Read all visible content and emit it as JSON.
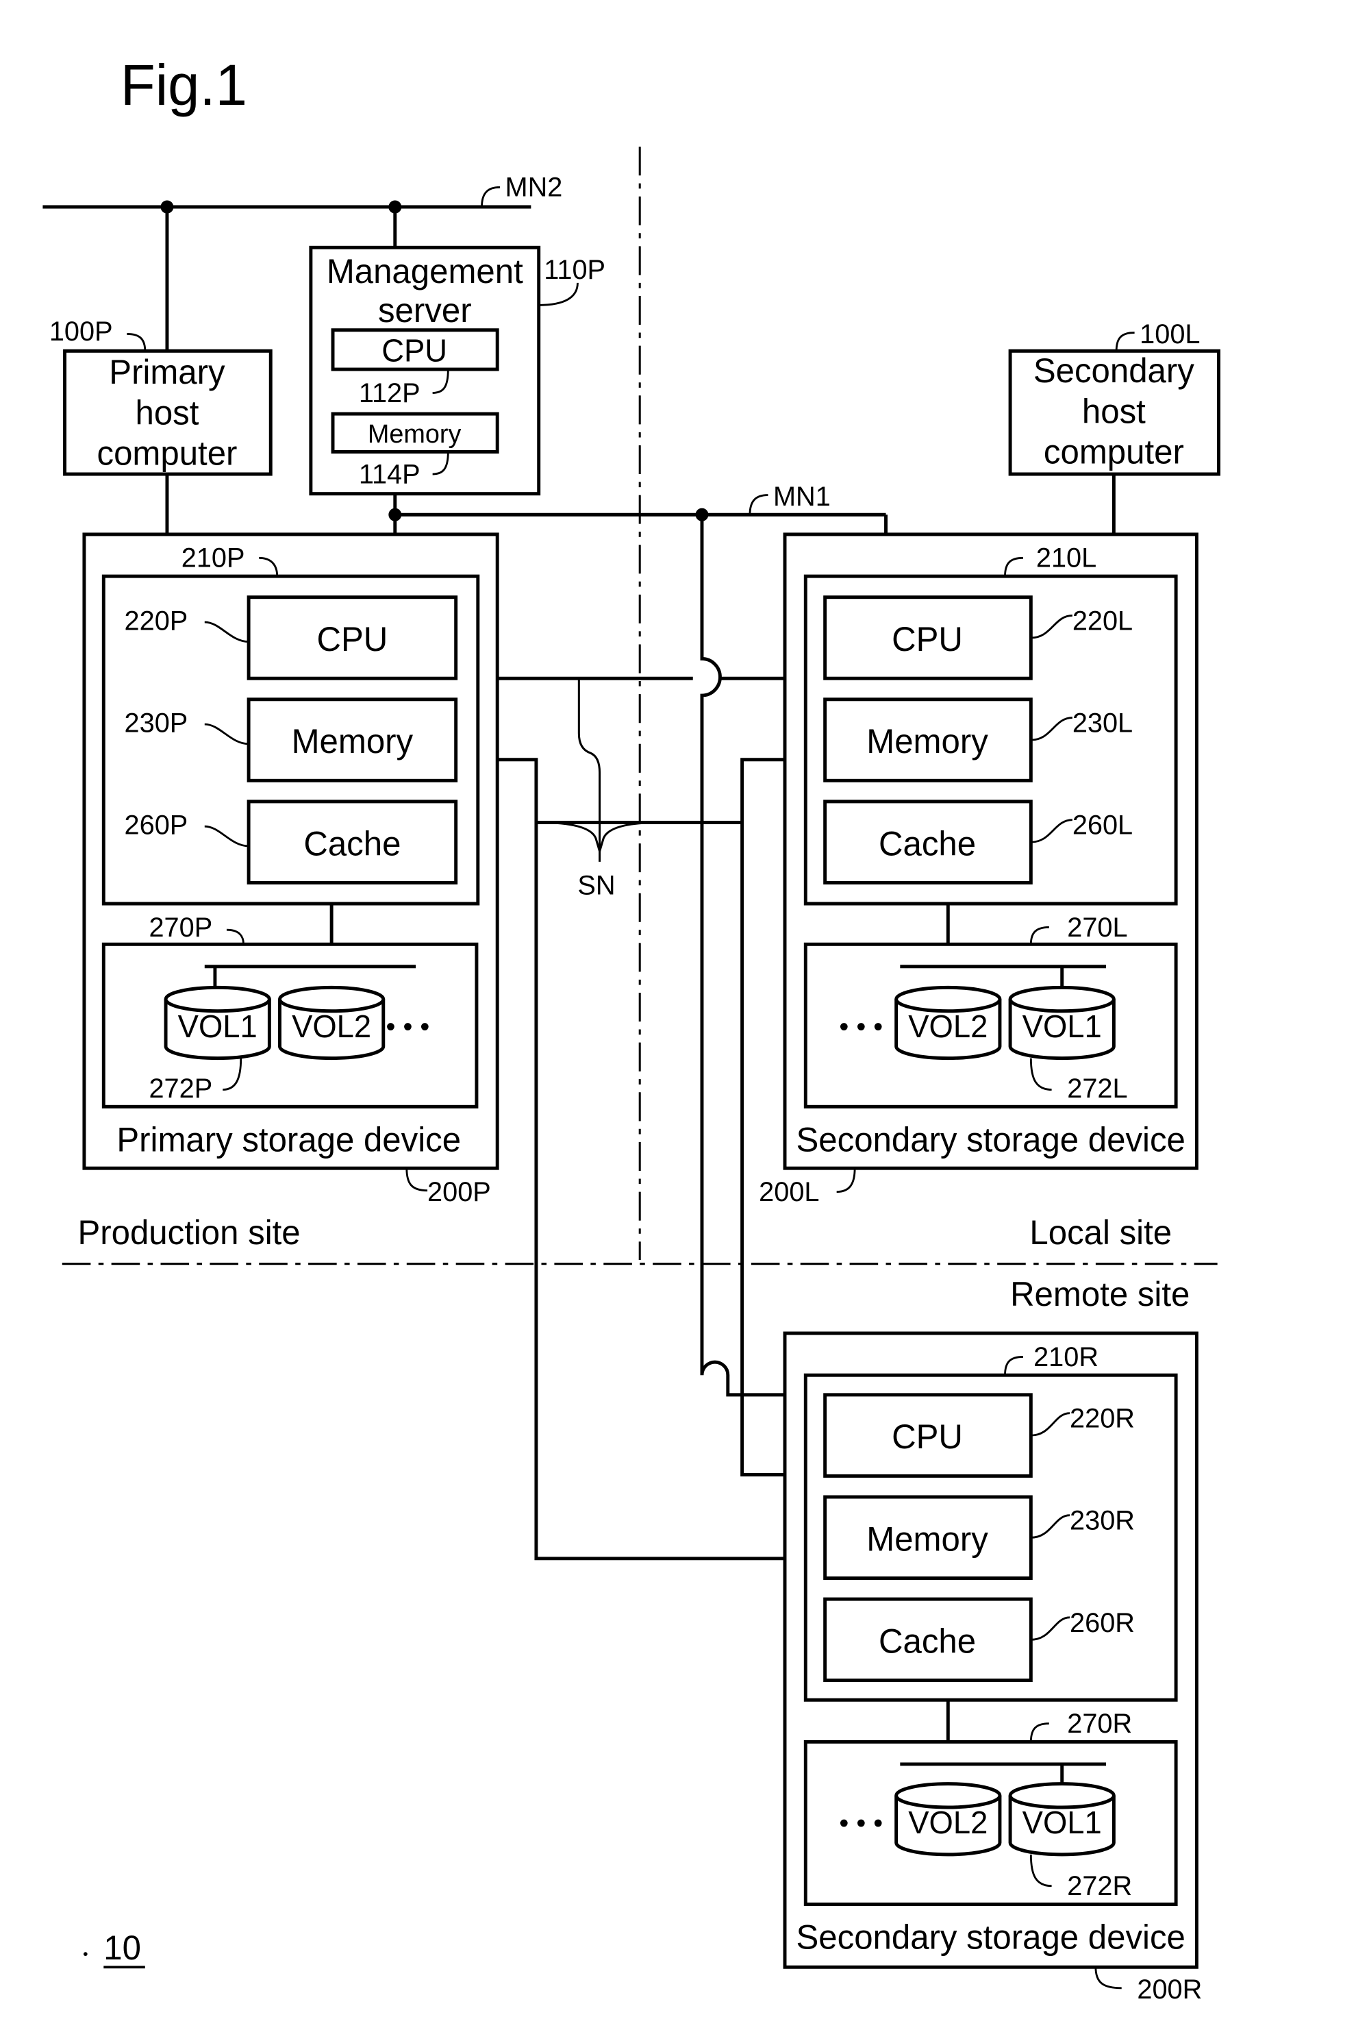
{
  "figure": {
    "title": "Fig.1",
    "system_ref": "10"
  },
  "networks": {
    "mn2": "MN2",
    "mn1": "MN1",
    "sn": "SN"
  },
  "sites": {
    "production": "Production site",
    "local": "Local site",
    "remote": "Remote site"
  },
  "primary_host": {
    "lines": [
      "Primary",
      "host",
      "computer"
    ],
    "ref": "100P"
  },
  "secondary_host": {
    "lines": [
      "Secondary",
      "host",
      "computer"
    ],
    "ref": "100L"
  },
  "management_server": {
    "lines": [
      "Management",
      "server"
    ],
    "ref": "110P",
    "cpu": {
      "label": "CPU",
      "ref": "112P"
    },
    "memory": {
      "label": "Memory",
      "ref": "114P"
    }
  },
  "primary_storage": {
    "name": "Primary storage device",
    "ref": "200P",
    "controller_ref": "210P",
    "cpu": {
      "label": "CPU",
      "ref": "220P"
    },
    "memory": {
      "label": "Memory",
      "ref": "230P"
    },
    "cache": {
      "label": "Cache",
      "ref": "260P"
    },
    "disk_ref": "270P",
    "volume_ref": "272P",
    "volumes": [
      "VOL1",
      "VOL2"
    ],
    "ellipsis": "• • •"
  },
  "local_storage": {
    "name": "Secondary storage device",
    "ref": "200L",
    "controller_ref": "210L",
    "cpu": {
      "label": "CPU",
      "ref": "220L"
    },
    "memory": {
      "label": "Memory",
      "ref": "230L"
    },
    "cache": {
      "label": "Cache",
      "ref": "260L"
    },
    "disk_ref": "270L",
    "volume_ref": "272L",
    "volumes": [
      "VOL2",
      "VOL1"
    ],
    "ellipsis": "• • •"
  },
  "remote_storage": {
    "name": "Secondary storage device",
    "ref": "200R",
    "controller_ref": "210R",
    "cpu": {
      "label": "CPU",
      "ref": "220R"
    },
    "memory": {
      "label": "Memory",
      "ref": "230R"
    },
    "cache": {
      "label": "Cache",
      "ref": "260R"
    },
    "disk_ref": "270R",
    "volume_ref": "272R",
    "volumes": [
      "VOL2",
      "VOL1"
    ],
    "ellipsis": "• • •"
  }
}
